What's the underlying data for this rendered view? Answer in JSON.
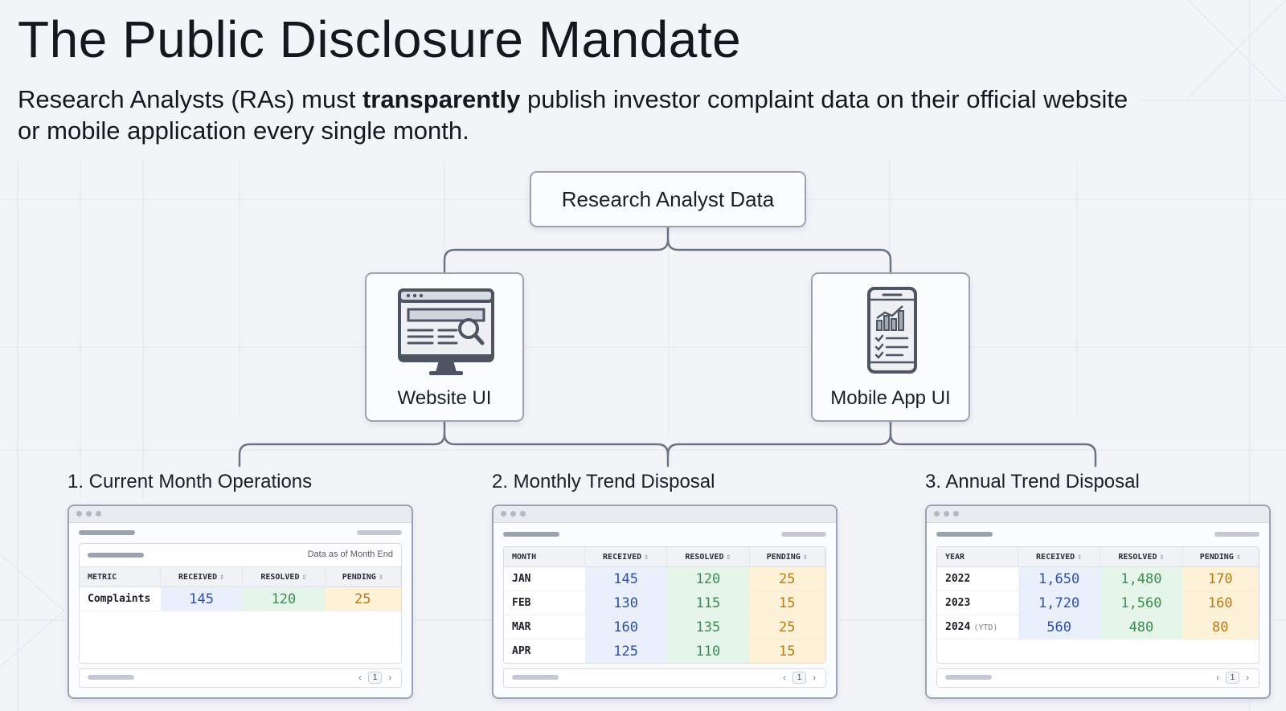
{
  "title": "The Public Disclosure Mandate",
  "subtitle": {
    "before": "Research Analysts (RAs) must ",
    "emphasis": "transparently",
    "after": " publish investor complaint data on their official website or mobile application every single month."
  },
  "root": {
    "label": "Research Analyst Data"
  },
  "channels": {
    "website": {
      "label": "Website UI",
      "icon": "monitor-search-icon"
    },
    "mobile": {
      "label": "Mobile App UI",
      "icon": "phone-chart-checklist-icon"
    }
  },
  "sections": [
    {
      "title": "1. Current Month Operations",
      "as_of": "Data as of Month End",
      "columns": [
        "METRIC",
        "RECEIVED",
        "RESOLVED",
        "PENDING"
      ],
      "rows": [
        {
          "label": "Complaints",
          "received": "145",
          "resolved": "120",
          "pending": "25"
        }
      ],
      "page": "1"
    },
    {
      "title": "2. Monthly Trend Disposal",
      "columns": [
        "MONTH",
        "RECEIVED",
        "RESOLVED",
        "PENDING"
      ],
      "rows": [
        {
          "label": "JAN",
          "received": "145",
          "resolved": "120",
          "pending": "25"
        },
        {
          "label": "FEB",
          "received": "130",
          "resolved": "115",
          "pending": "15"
        },
        {
          "label": "MAR",
          "received": "160",
          "resolved": "135",
          "pending": "25"
        },
        {
          "label": "APR",
          "received": "125",
          "resolved": "110",
          "pending": "15"
        }
      ],
      "page": "1"
    },
    {
      "title": "3. Annual Trend Disposal",
      "columns": [
        "YEAR",
        "RECEIVED",
        "RESOLVED",
        "PENDING"
      ],
      "rows": [
        {
          "label": "2022",
          "received": "1,650",
          "resolved": "1,480",
          "pending": "170"
        },
        {
          "label": "2023",
          "received": "1,720",
          "resolved": "1,560",
          "pending": "160"
        },
        {
          "label": "2024",
          "tag": "(YTD)",
          "received": "560",
          "resolved": "480",
          "pending": "80"
        }
      ],
      "page": "1"
    }
  ],
  "colors": {
    "received": "#2e4fa3",
    "resolved": "#3e8b55",
    "pending": "#b97a14",
    "connector": "#6b7585"
  }
}
